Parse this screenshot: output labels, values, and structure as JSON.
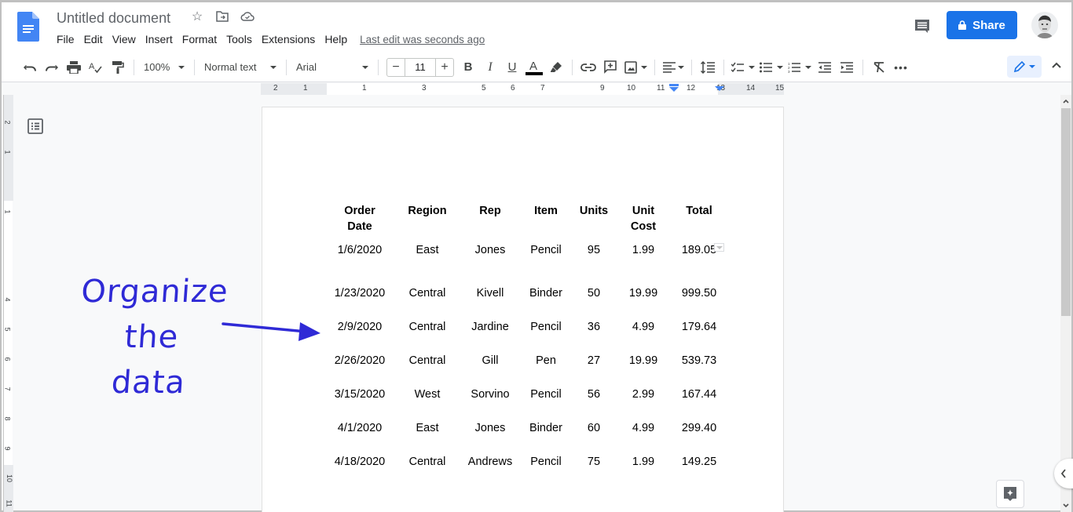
{
  "app": {
    "title": "Untitled document",
    "last_edit": "Last edit was seconds ago",
    "share_label": "Share",
    "brand_color": "#1a73e8",
    "menu": [
      "File",
      "Edit",
      "View",
      "Insert",
      "Format",
      "Tools",
      "Extensions",
      "Help"
    ]
  },
  "toolbar": {
    "zoom": "100%",
    "style": "Normal text",
    "font": "Arial",
    "font_size": "11",
    "minus": "−",
    "plus": "+"
  },
  "ruler": {
    "horizontal_labels": [
      "2",
      "1",
      "1",
      "3",
      "5",
      "6",
      "7",
      "9",
      "10",
      "11",
      "12",
      "13",
      "14",
      "15"
    ],
    "vertical_labels": [
      "2",
      "1",
      "1",
      "4",
      "5",
      "6",
      "7",
      "8",
      "9",
      "10",
      "11"
    ]
  },
  "table": {
    "headers": [
      [
        "Order",
        "Date"
      ],
      [
        "Region"
      ],
      [
        "Rep"
      ],
      [
        "Item"
      ],
      [
        "Units"
      ],
      [
        "Unit",
        "Cost"
      ],
      [
        "Total"
      ]
    ],
    "rows": [
      [
        "1/6/2020",
        "East",
        "Jones",
        "Pencil",
        "95",
        "1.99",
        "189.05"
      ],
      [
        "1/23/2020",
        "Central",
        "Kivell",
        "Binder",
        "50",
        "19.99",
        "999.50"
      ],
      [
        "2/9/2020",
        "Central",
        "Jardine",
        "Pencil",
        "36",
        "4.99",
        "179.64"
      ],
      [
        "2/26/2020",
        "Central",
        "Gill",
        "Pen",
        "27",
        "19.99",
        "539.73"
      ],
      [
        "3/15/2020",
        "West",
        "Sorvino",
        "Pencil",
        "56",
        "2.99",
        "167.44"
      ],
      [
        "4/1/2020",
        "East",
        "Jones",
        "Binder",
        "60",
        "4.99",
        "299.40"
      ],
      [
        "4/18/2020",
        "Central",
        "Andrews",
        "Pencil",
        "75",
        "1.99",
        "149.25"
      ]
    ]
  },
  "annotation": {
    "line1": "Organize the",
    "line2": "data",
    "color": "#2f2ad6"
  }
}
